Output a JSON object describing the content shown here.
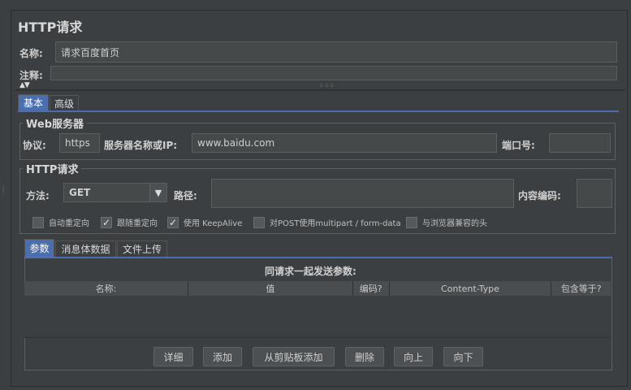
{
  "title": "HTTP请求",
  "name_field": {
    "label": "名称:",
    "value": "请求百度首页"
  },
  "comment_field": {
    "label": "注释:",
    "value": ""
  },
  "tabs": [
    {
      "label": "基本"
    },
    {
      "label": "高级"
    }
  ],
  "web_server": {
    "title": "Web服务器",
    "protocol_label": "协议:",
    "protocol_value": "https",
    "server_label": "服务器名称或IP:",
    "server_value": "www.baidu.com",
    "port_label": "端口号:",
    "port_value": ""
  },
  "http_request": {
    "title": "HTTP请求",
    "method_label": "方法:",
    "method_value": "GET",
    "path_label": "路径:",
    "path_value": "",
    "encoding_label": "内容编码:",
    "encoding_value": ""
  },
  "checkboxes": [
    {
      "label": "自动重定向",
      "checked": false
    },
    {
      "label": "跟随重定向",
      "checked": true
    },
    {
      "label": "使用 KeepAlive",
      "checked": true
    },
    {
      "label": "对POST使用multipart / form-data",
      "checked": false
    },
    {
      "label": "与浏览器兼容的头",
      "checked": false
    }
  ],
  "inner_tabs": [
    {
      "label": "参数"
    },
    {
      "label": "消息体数据"
    },
    {
      "label": "文件上传"
    }
  ],
  "params": {
    "caption": "同请求一起发送参数:",
    "columns": [
      "名称:",
      "值",
      "编码?",
      "Content-Type",
      "包含等于?"
    ]
  },
  "buttons": [
    {
      "label": "详细"
    },
    {
      "label": "添加"
    },
    {
      "label": "从剪贴板添加"
    },
    {
      "label": "删除"
    },
    {
      "label": "向上"
    },
    {
      "label": "向下"
    }
  ],
  "colors": {
    "background": "#3c3f41",
    "tab_active": "#4b6eaf",
    "input": "#45494a"
  }
}
